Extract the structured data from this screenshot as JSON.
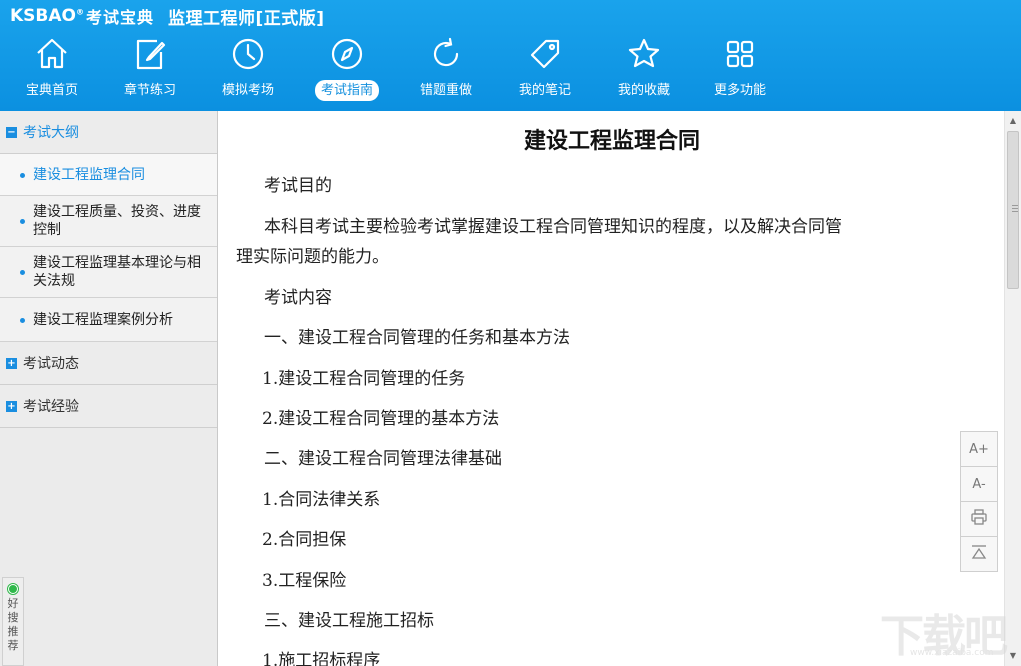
{
  "header": {
    "logo_text": "KSBAO",
    "logo_mark": "®",
    "logo_cn": "考试宝典",
    "app_title": "监理工程师[正式版]"
  },
  "nav": [
    {
      "label": "宝典首页",
      "icon": "home-icon",
      "active": false
    },
    {
      "label": "章节练习",
      "icon": "edit-icon",
      "active": false
    },
    {
      "label": "模拟考场",
      "icon": "clock-icon",
      "active": false
    },
    {
      "label": "考试指南",
      "icon": "compass-icon",
      "active": true
    },
    {
      "label": "错题重做",
      "icon": "refresh-icon",
      "active": false
    },
    {
      "label": "我的笔记",
      "icon": "tag-icon",
      "active": false
    },
    {
      "label": "我的收藏",
      "icon": "star-icon",
      "active": false
    },
    {
      "label": "更多功能",
      "icon": "grid-icon",
      "active": false
    }
  ],
  "sidebar": {
    "sections": [
      {
        "label": "考试大纲",
        "toggle": "−",
        "open": true
      },
      {
        "label": "考试动态",
        "toggle": "+",
        "open": false
      },
      {
        "label": "考试经验",
        "toggle": "+",
        "open": false
      }
    ],
    "items": [
      {
        "label": "建设工程监理合同",
        "active": true
      },
      {
        "label": "建设工程质量、投资、进度控制",
        "active": false
      },
      {
        "label": "建设工程监理基本理论与相关法规",
        "active": false
      },
      {
        "label": "建设工程监理案例分析",
        "active": false
      }
    ],
    "recommend_text": "好搜推荐"
  },
  "document": {
    "title": "建设工程监理合同",
    "lines": [
      "考试目的",
      "本科目考试主要检验考试掌握建设工程合同管理知识的程度，以及解决合同管",
      "理实际问题的能力。",
      "考试内容",
      "一、建设工程合同管理的任务和基本方法",
      "1.建设工程合同管理的任务",
      "2.建设工程合同管理的基本方法",
      "二、建设工程合同管理法律基础",
      "1.合同法律关系",
      "2.合同担保",
      "3.工程保险",
      "三、建设工程施工招标",
      "1.施工招标程序"
    ]
  },
  "tools": {
    "font_increase": "A+",
    "font_decrease": "A-",
    "print_icon": "print-icon",
    "top_icon": "back-to-top-icon"
  },
  "scrollbar": {
    "up": "▲",
    "down": "▼"
  },
  "watermark": {
    "text": "下载吧",
    "sub": "www.xiazaiba.com"
  },
  "colors": {
    "header": "#1aa3ec",
    "accent": "#1a8ee0",
    "sidebar_bg": "#ebebeb"
  }
}
